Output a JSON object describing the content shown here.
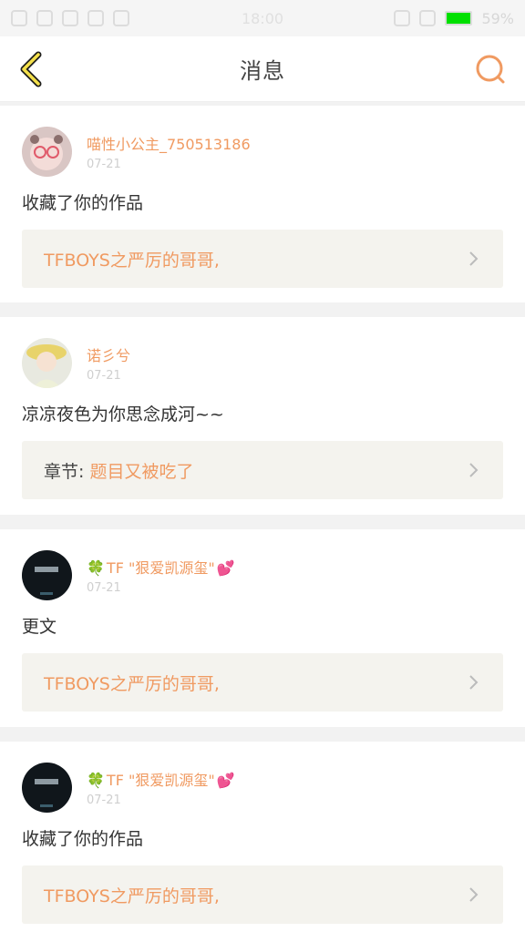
{
  "status_bar": {
    "time": "18:00",
    "battery": "59%"
  },
  "header": {
    "title": "消息"
  },
  "feed": [
    {
      "user": "喵性小公主_750513186",
      "date": "07-21",
      "action": "收藏了你的作品",
      "work_label": "",
      "work_title": "TFBOYS之严厉的哥哥,"
    },
    {
      "user": "诺彡兮",
      "date": "07-21",
      "action": "凉凉夜色为你思念成河~~",
      "work_label": "章节:",
      "work_title": "题目又被吃了"
    },
    {
      "user_prefix": "🍀",
      "user": "TF \"狠爱凯源玺\"",
      "user_suffix": "💕",
      "date": "07-21",
      "action": "更文",
      "work_label": "",
      "work_title": "TFBOYS之严厉的哥哥,"
    },
    {
      "user_prefix": "🍀",
      "user": "TF \"狠爱凯源玺\"",
      "user_suffix": "💕",
      "date": "07-21",
      "action": "收藏了你的作品",
      "work_label": "",
      "work_title": "TFBOYS之严厉的哥哥,"
    }
  ]
}
